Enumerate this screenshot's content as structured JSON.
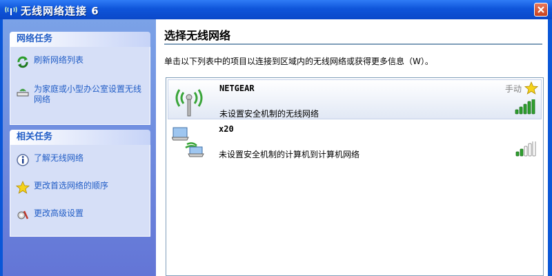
{
  "window": {
    "title": "无线网络连接 6"
  },
  "sidebar": {
    "network_tasks": {
      "header": "网络任务",
      "items": [
        {
          "label": "刷新网络列表",
          "icon": "refresh-icon"
        },
        {
          "label": "为家庭或小型办公室设置无线网络",
          "icon": "setup-wireless-icon"
        }
      ]
    },
    "related_tasks": {
      "header": "相关任务",
      "items": [
        {
          "label": "了解无线网络",
          "icon": "info-icon"
        },
        {
          "label": "更改首选网络的顺序",
          "icon": "star-icon"
        },
        {
          "label": "更改高级设置",
          "icon": "settings-icon"
        }
      ]
    }
  },
  "main": {
    "heading": "选择无线网络",
    "description": "单击以下列表中的项目以连接到区域内的无线网络或获得更多信息（W）。",
    "networks": [
      {
        "name": "NETGEAR",
        "status": "未设置安全机制的无线网络",
        "mode": "手动",
        "signal_bars": 5,
        "preferred": true
      },
      {
        "name": "x20",
        "status": "未设置安全机制的计算机到计算机网络",
        "mode": "",
        "signal_bars": 2,
        "preferred": false
      }
    ]
  },
  "colors": {
    "titlebar": "#0f55da",
    "task_link": "#215dc6",
    "signal_on": "#2ea02e",
    "signal_off": "#ffffff"
  }
}
